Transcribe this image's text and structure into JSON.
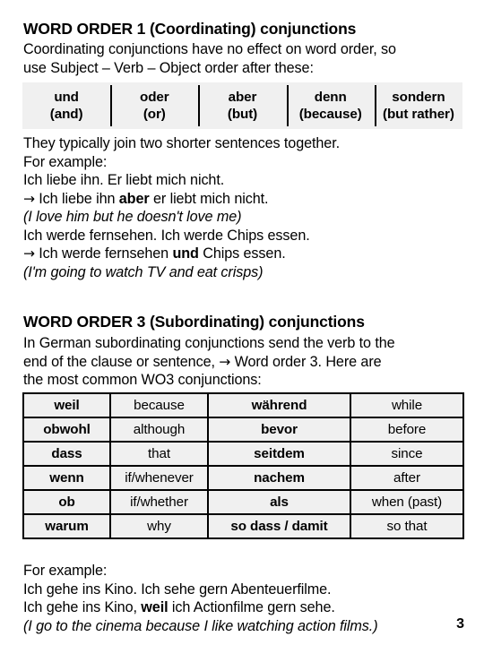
{
  "section1": {
    "heading": "WORD ORDER 1 (Coordinating) conjunctions",
    "intro_line1": "Coordinating conjunctions have no effect on word order, so",
    "intro_line2": "use Subject – Verb – Object order after these:",
    "table": {
      "columns": [
        {
          "german": "und",
          "english": "(and)"
        },
        {
          "german": "oder",
          "english": "(or)"
        },
        {
          "german": "aber",
          "english": "(but)"
        },
        {
          "german": "denn",
          "english": "(because)"
        },
        {
          "german": "sondern",
          "english": "(but rather)"
        }
      ]
    },
    "examples": {
      "line1": "They typically join two shorter sentences together.",
      "line2": "For example:",
      "line3": "Ich liebe ihn. Er liebt mich nicht.",
      "line4_arrow": "→",
      "line4_a": " Ich liebe ihn ",
      "line4_bold": "aber",
      "line4_b": " er liebt mich nicht.",
      "line5_italic": "(I love him but he doesn't love me)",
      "line6": "Ich werde fernsehen. Ich werde Chips essen.",
      "line7_arrow": "→",
      "line7_a": " Ich werde fernsehen ",
      "line7_bold": "und",
      "line7_b": " Chips essen.",
      "line8_italic": "(I'm going to watch TV and eat crisps)"
    }
  },
  "section2": {
    "heading": "WORD ORDER 3 (Subordinating) conjunctions",
    "intro_line1": "In German subordinating conjunctions send the verb to the",
    "intro_line2_a": "end of the clause or sentence, ",
    "intro_line2_arrow": "→",
    "intro_line2_b": " Word order 3.  Here are",
    "intro_line3": "the most common WO3 conjunctions:",
    "table": {
      "rows": [
        {
          "de1": "weil",
          "en1": "because",
          "de2": "während",
          "en2": "while"
        },
        {
          "de1": "obwohl",
          "en1": "although",
          "de2": "bevor",
          "en2": "before"
        },
        {
          "de1": "dass",
          "en1": "that",
          "de2": "seitdem",
          "en2": "since"
        },
        {
          "de1": "wenn",
          "en1": "if/whenever",
          "de2": "nachem",
          "en2": "after"
        },
        {
          "de1": "ob",
          "en1": "if/whether",
          "de2": "als",
          "en2": "when (past)"
        },
        {
          "de1": "warum",
          "en1": "why",
          "de2": "so dass / damit",
          "en2": "so that"
        }
      ]
    },
    "examples": {
      "line1": "For example:",
      "line2": "Ich gehe ins Kino. Ich sehe gern Abenteuerfilme.",
      "line3_a": "Ich gehe ins Kino, ",
      "line3_bold": "weil",
      "line3_b": " ich Actionfilme gern sehe.",
      "line4_italic": "(I go to the cinema because I like watching action films.)"
    }
  },
  "footer": {
    "page_number": "3"
  }
}
